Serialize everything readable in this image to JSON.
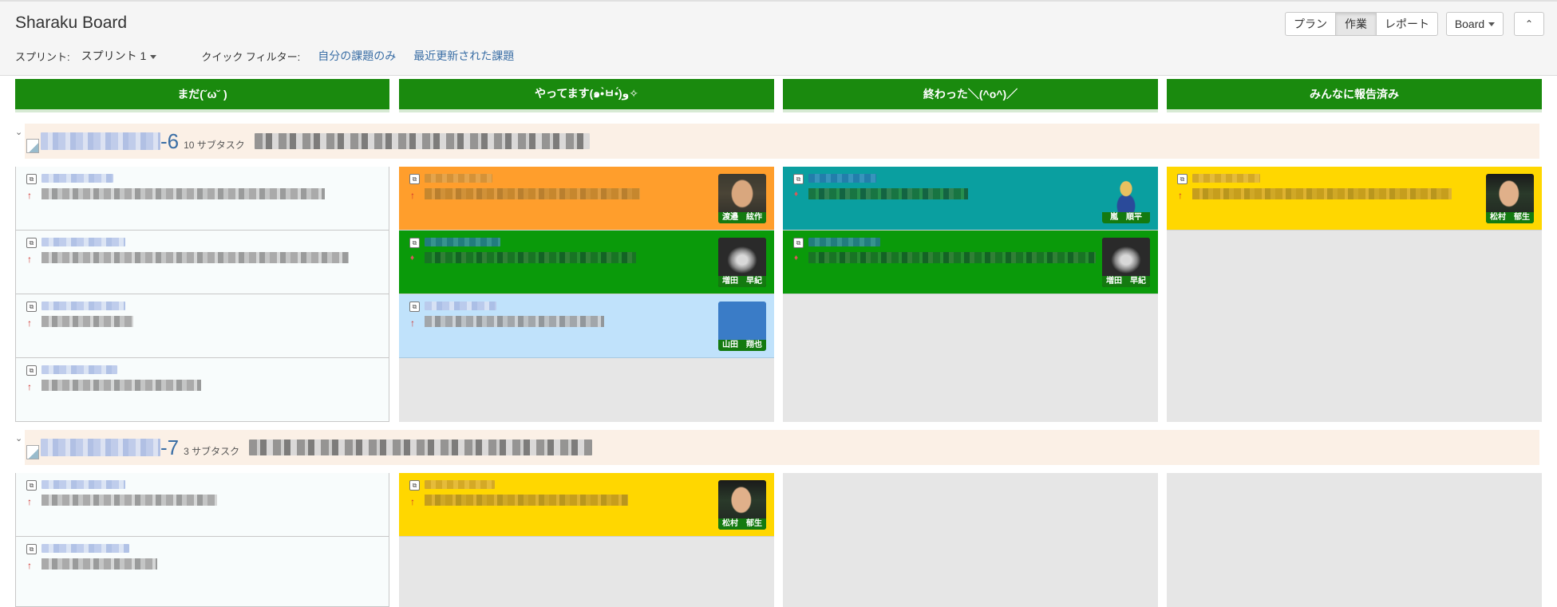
{
  "app": {
    "title": "Sharaku Board"
  },
  "filters": {
    "sprint_label": "スプリント:",
    "sprint_value": "スプリント 1",
    "quick_label": "クイック フィルター:",
    "quick_mine": "自分の課題のみ",
    "quick_recent": "最近更新された課題"
  },
  "toolbar": {
    "plan": "プラン",
    "work": "作業",
    "report": "レポート",
    "board": "Board",
    "collapse": "«"
  },
  "columns": [
    {
      "label": "まだ(˘ω˘ )"
    },
    {
      "label": "やってます(๑•̀ㅂ•́)و✧"
    },
    {
      "label": "終わった＼(^o^)／"
    },
    {
      "label": "みんなに報告済み"
    }
  ],
  "swimlanes": [
    {
      "key_suffix": "-6",
      "subtask_text": "10 サブタスク"
    },
    {
      "key_suffix": "-7",
      "subtask_text": "3 サブタスク"
    }
  ],
  "assignees": {
    "watanabe": "渡邉　絃作",
    "masuda": "増田　早紀",
    "yamada": "山田　翔也",
    "arashi": "嵐　順平",
    "matsumura": "松村　郁生"
  },
  "colors": {
    "column_header": "#1a8a0e",
    "orange": "#ff9e2c",
    "green": "#0a9a0a",
    "teal": "#0a9fa0",
    "yellow": "#ffd700",
    "lightblue": "#c0e2fb",
    "link": "#3a6ea5"
  }
}
